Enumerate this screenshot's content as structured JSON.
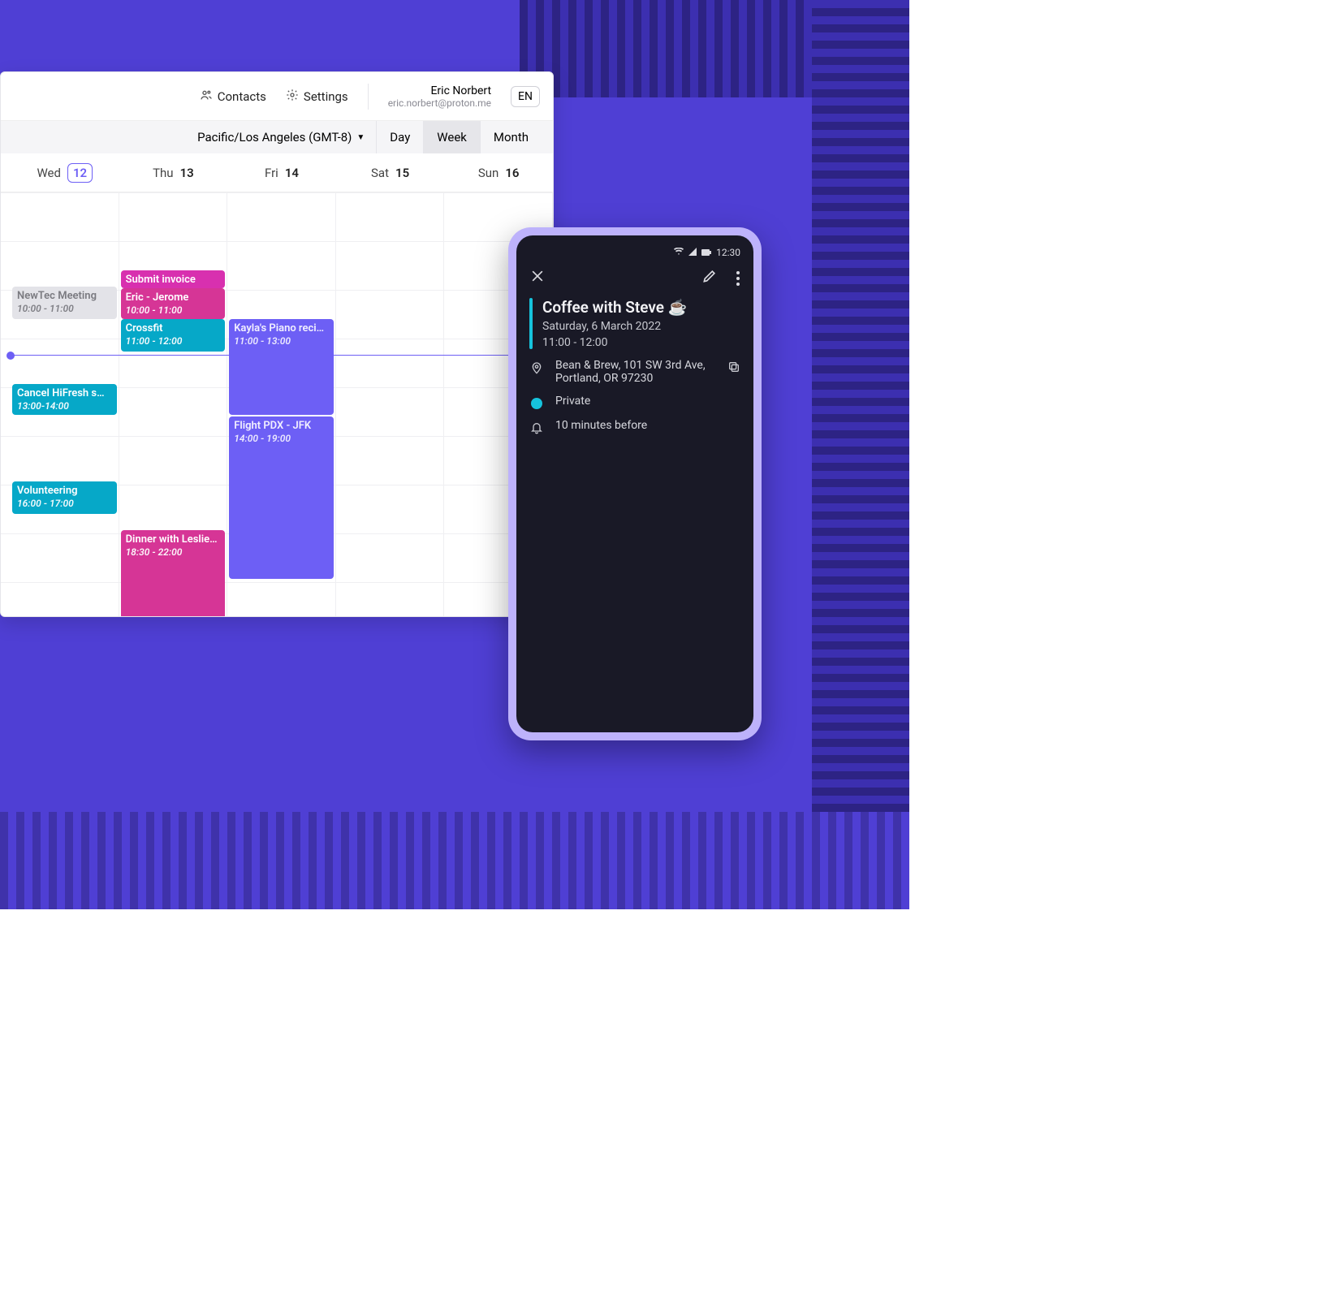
{
  "topbar": {
    "contacts": "Contacts",
    "settings": "Settings",
    "user_name": "Eric Norbert",
    "user_email": "eric.norbert@proton.me",
    "lang": "EN"
  },
  "viewbar": {
    "timezone": "Pacific/Los Angeles (GMT-8)",
    "tabs": {
      "day": "Day",
      "week": "Week",
      "month": "Month"
    },
    "active": "Week"
  },
  "days": [
    {
      "label": "Wed",
      "num": "12",
      "today": true
    },
    {
      "label": "Thu",
      "num": "13",
      "today": false
    },
    {
      "label": "Fri",
      "num": "14",
      "today": false
    },
    {
      "label": "Sat",
      "num": "15",
      "today": false
    },
    {
      "label": "Sun",
      "num": "16",
      "today": false
    }
  ],
  "events": {
    "newtec": {
      "title": "NewTec Meeting",
      "hours": "10:00 - 11:00"
    },
    "cancel": {
      "title": "Cancel HiFresh s…",
      "hours": "13:00-14:00"
    },
    "volunteer": {
      "title": "Volunteering",
      "hours": "16:00 - 17:00"
    },
    "submit": {
      "title": "Submit invoice",
      "hours": ""
    },
    "ericj": {
      "title": "Eric - Jerome",
      "hours": "10:00 - 11:00"
    },
    "crossfit": {
      "title": "Crossfit",
      "hours": "11:00 - 12:00"
    },
    "dinner": {
      "title": "Dinner with Leslie…",
      "hours": "18:30 - 22:00"
    },
    "kayla": {
      "title": "Kayla's Piano reci…",
      "hours": "11:00 - 13:00"
    },
    "flight": {
      "title": "Flight PDX - JFK",
      "hours": "14:00 - 19:00"
    }
  },
  "phone": {
    "clock": "12:30",
    "title": "Coffee with Steve ☕",
    "date": "Saturday, 6 March 2022",
    "time": "11:00 - 12:00",
    "location": "Bean & Brew, 101 SW 3rd Ave, Portland, OR 97230",
    "visibility": "Private",
    "reminder": "10 minutes before"
  },
  "colors": {
    "accent_purple": "#6d5ff5",
    "accent_magenta": "#d63596",
    "accent_cyan": "#06a8c8",
    "accent_teal": "#16c3dd"
  }
}
